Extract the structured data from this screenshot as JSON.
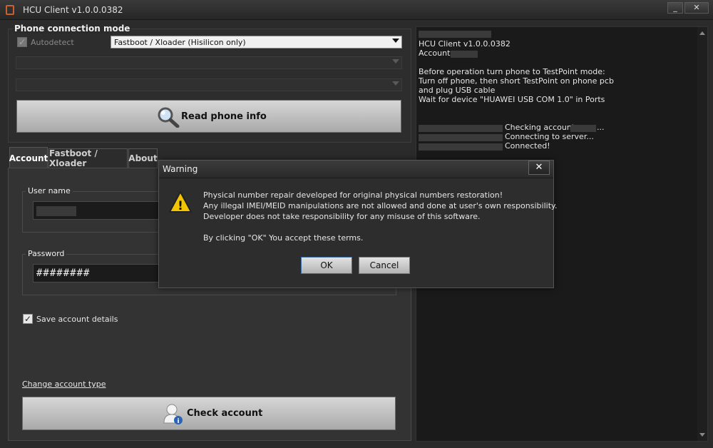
{
  "window": {
    "title": "HCU Client   v1.0.0.0382",
    "minimize_label": "_",
    "close_label": "✕"
  },
  "connection": {
    "group_title": "Phone connection mode",
    "autodetect_label": "Autodetect",
    "mode_value": "Fastboot / Xloader (Hisilicon only)",
    "read_button": "Read phone info"
  },
  "tabs": [
    {
      "label": "Account"
    },
    {
      "label": "Fastboot / Xloader"
    },
    {
      "label": "About"
    }
  ],
  "account": {
    "username_label": "User name",
    "password_label": "Password",
    "password_value": "########",
    "save_label": "Save account details",
    "change_type_link": "Change account type",
    "check_button": "Check account"
  },
  "log": {
    "lines": [
      "HCU Client   v1.0.0.0382",
      "Account:",
      "Before operation turn phone to TestPoint mode:",
      "Turn off phone, then short TestPoint on phone pcb",
      "and plug USB cable",
      "Wait for device \"HUAWEI USB COM 1.0\" in Ports",
      "Checking account",
      "Connecting to server...",
      "Connected!"
    ],
    "ellipsis": "..."
  },
  "dialog": {
    "title": "Warning",
    "close_label": "✕",
    "lines": [
      "Physical number repair developed for original physical numbers restoration!",
      "Any illegal IMEI/MEID manipulations are not allowed and done at user's own responsibility.",
      "Developer does  not take responsibility for any misuse of this software.",
      "By clicking \"OK\" You accept these terms."
    ],
    "ok_label": "OK",
    "cancel_label": "Cancel"
  },
  "icons": {
    "checkmark": "✓",
    "warning_glyph": "!",
    "info_glyph": "i"
  },
  "colors": {
    "background": "#2b2b2b",
    "log_background": "#1a1a1a",
    "warning": "#f2c500",
    "accent": "#3d6ea8"
  }
}
